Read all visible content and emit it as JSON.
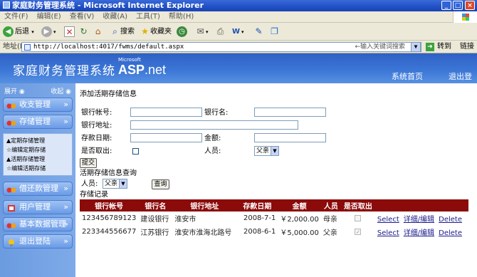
{
  "window": {
    "title": "家庭财务管理系统 - Microsoft Internet Explorer"
  },
  "menu": {
    "items": [
      "文件(F)",
      "编辑(E)",
      "查看(V)",
      "收藏(A)",
      "工具(T)",
      "帮助(H)"
    ]
  },
  "toolbar": {
    "back": "后退",
    "search": "搜索",
    "favorites": "收藏夹"
  },
  "address": {
    "label": "地址(D)",
    "url": "http://localhost:4017/fwms/default.aspx",
    "search_hint": "←输入关键词搜索",
    "go": "转到",
    "links": "链接"
  },
  "header": {
    "site_title": "家庭财务管理系统",
    "logo_ms": "Microsoft",
    "logo_asp": "ASP",
    "logo_net": ".net",
    "nav_home": "系统首页",
    "nav_logout": "退出登陆"
  },
  "sidebar": {
    "expand": "展开",
    "collapse": "收起",
    "menus": [
      "收支管理",
      "存储管理",
      "借还款管理",
      "用户管理",
      "基本数据管理",
      "退出登陆"
    ],
    "sub_items": [
      "▲定期存储管理",
      "☆编辑定期存储",
      "▲活期存储管理",
      "☆编辑活期存储"
    ]
  },
  "form": {
    "section_title": "添加活期存储信息",
    "bank_account_label": "银行帐号:",
    "bank_name_label": "银行名:",
    "bank_address_label": "银行地址:",
    "deposit_date_label": "存款日期:",
    "amount_label": "金额:",
    "withdrawn_label": "是否取出:",
    "person_label": "人员:",
    "person_value": "父亲",
    "submit": "提交"
  },
  "query": {
    "title": "活期存储信息查询",
    "person_label": "人员:",
    "person_value": "父亲",
    "button": "查询"
  },
  "records": {
    "title": "存储记录",
    "columns": [
      "银行帐号",
      "银行名",
      "银行地址",
      "存款日期",
      "金额",
      "人员",
      "是否取出"
    ],
    "rows": [
      {
        "account": "123456789123",
        "bank": "建设银行",
        "address": "淮安市",
        "date": "2008-7-1",
        "amount": "￥2,000.00",
        "person": "母亲",
        "withdrawn": false,
        "select": "Select",
        "edit": "详细/编辑",
        "delete": "Delete"
      },
      {
        "account": "223344556677",
        "bank": "江苏银行",
        "address": "淮安市淮海北路号",
        "date": "2008-6-1",
        "amount": "￥5,000.00",
        "person": "父亲",
        "withdrawn": true,
        "select": "Select",
        "edit": "详细/编辑",
        "delete": "Delete"
      }
    ]
  },
  "colors": {
    "header_blue": "#2f61c4",
    "table_header": "#8b0a0a",
    "sidebar_blue": "#6b9be0"
  }
}
